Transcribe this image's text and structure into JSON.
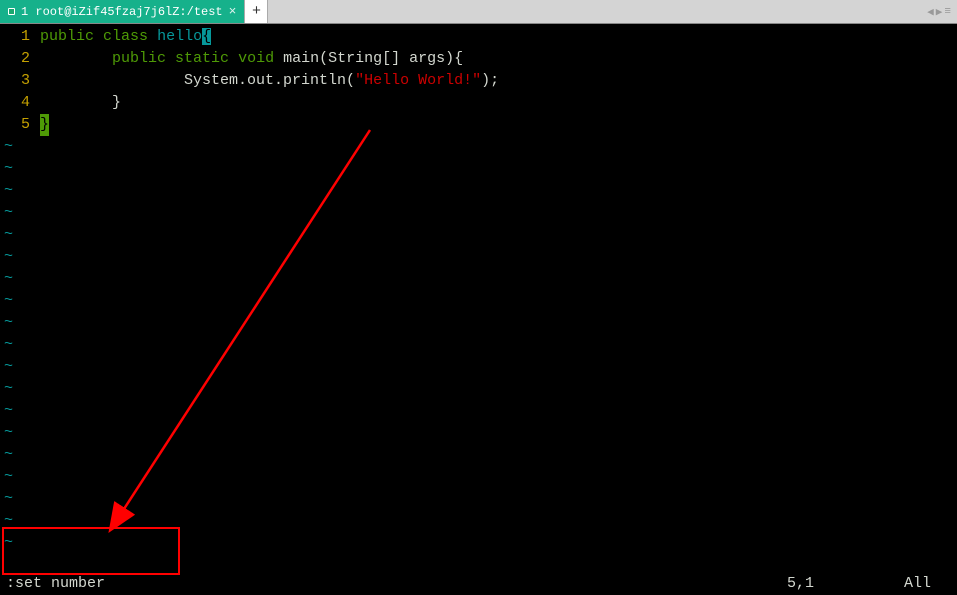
{
  "tab": {
    "title": "1 root@iZif45fzaj7j6lZ:/test",
    "close_char": "×",
    "add_char": "+"
  },
  "nav": {
    "left": "◀",
    "right": "▶",
    "menu": "≡"
  },
  "code": {
    "lines": [
      {
        "n": "1",
        "segments": [
          {
            "cls": "kw-public",
            "t": "public"
          },
          {
            "cls": "plain",
            "t": " "
          },
          {
            "cls": "kw-class",
            "t": "class"
          },
          {
            "cls": "plain",
            "t": " "
          },
          {
            "cls": "ident",
            "t": "hello"
          },
          {
            "cls": "brace-hl",
            "t": "{"
          }
        ]
      },
      {
        "n": "2",
        "segments": [
          {
            "cls": "plain",
            "t": "        "
          },
          {
            "cls": "kw-public",
            "t": "public"
          },
          {
            "cls": "plain",
            "t": " "
          },
          {
            "cls": "kw-static",
            "t": "static"
          },
          {
            "cls": "plain",
            "t": " "
          },
          {
            "cls": "kw-void",
            "t": "void"
          },
          {
            "cls": "plain",
            "t": " main(String[] args){"
          }
        ]
      },
      {
        "n": "3",
        "segments": [
          {
            "cls": "plain",
            "t": "                System.out.println("
          },
          {
            "cls": "string",
            "t": "\"Hello World!\""
          },
          {
            "cls": "plain",
            "t": ");"
          }
        ]
      },
      {
        "n": "4",
        "segments": [
          {
            "cls": "plain",
            "t": "        }"
          }
        ]
      },
      {
        "n": "5",
        "segments": [
          {
            "cls": "cursor-block",
            "t": "}"
          }
        ]
      }
    ],
    "tilde": "~",
    "tilde_count": 19
  },
  "status": {
    "command": ":set number",
    "position": "5,1",
    "scroll": "All"
  }
}
